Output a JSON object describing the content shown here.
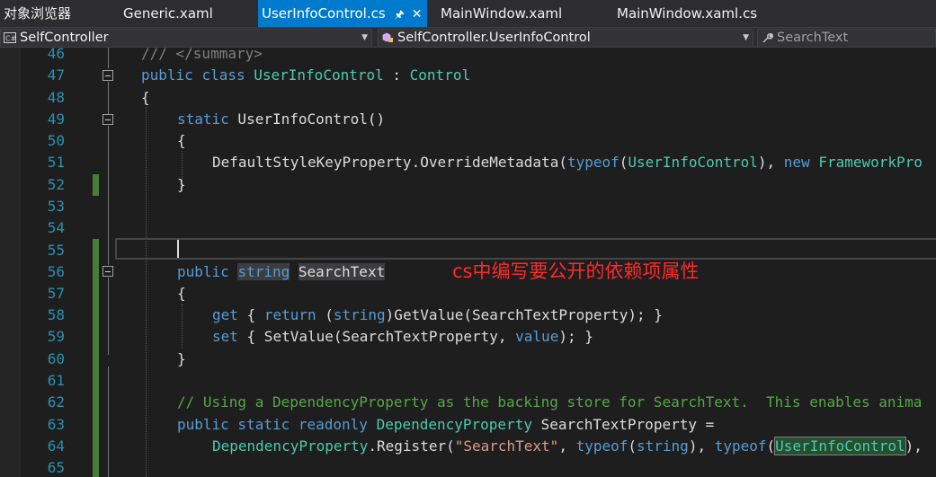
{
  "tabs": [
    {
      "label": "对象浏览器"
    },
    {
      "label": "Generic.xaml"
    },
    {
      "label": "UserInfoControl.cs",
      "active": true,
      "pin_icon": "pin-icon",
      "close_icon": "close-icon"
    },
    {
      "label": "MainWindow.xaml"
    },
    {
      "label": "MainWindow.xaml.cs"
    }
  ],
  "navbar": {
    "project": "SelfController",
    "type": "SelfController.UserInfoControl",
    "member": "SearchText",
    "project_icon": "csharp-project-icon",
    "type_icon": "class-icon",
    "member_icon": "wrench-property-icon"
  },
  "editor": {
    "line_numbers": [
      "46",
      "47",
      "48",
      "49",
      "50",
      "51",
      "52",
      "53",
      "54",
      "55",
      "56",
      "57",
      "58",
      "59",
      "60",
      "61",
      "62",
      "63",
      "64",
      "65"
    ],
    "lines": {
      "l46": "/// </summary>",
      "l47_kw1": "public",
      "l47_kw2": "class",
      "l47_name": "UserInfoControl",
      "l47_colon": " : ",
      "l47_base": "Control",
      "l48": "{",
      "l49_kw": "static",
      "l49_rest": " UserInfoControl()",
      "l50": "{",
      "l51_a": "DefaultStyleKeyProperty",
      "l51_b": ".OverrideMetadata(",
      "l51_kw": "typeof",
      "l51_c": "(",
      "l51_ty": "UserInfoControl",
      "l51_d": "), ",
      "l51_new": "new",
      "l51_ty2": " FrameworkPro",
      "l52": "}",
      "l56_kw": "public",
      "l56_ty": "string",
      "l56_name": "SearchText",
      "l57": "{",
      "l58_get": "get",
      "l58_a": " { ",
      "l58_ret": "return",
      "l58_b": " (",
      "l58_str": "string",
      "l58_c": ")GetValue(SearchTextProperty); }",
      "l59_set": "set",
      "l59_a": " { SetValue(SearchTextProperty, ",
      "l59_val": "value",
      "l59_b": "); }",
      "l60": "}",
      "l62": "// Using a DependencyProperty as the backing store for SearchText.  This enables anima",
      "l63_kw": "public static readonly",
      "l63_ty": "DependencyProperty",
      "l63_rest": " SearchTextProperty =",
      "l64_ty": "DependencyProperty",
      "l64_a": ".Register(",
      "l64_str": "\"SearchText\"",
      "l64_b": ", ",
      "l64_kw1": "typeof",
      "l64_c": "(",
      "l64_str2": "string",
      "l64_d": "), ",
      "l64_kw2": "typeof",
      "l64_e": "(",
      "l64_ty2": "UserInfoControl",
      "l64_f": "),"
    }
  },
  "annotation": "cs中编写要公开的依赖项属性",
  "colors": {
    "keyword": "#569cd6",
    "type": "#4ec9b0",
    "string": "#d69d85",
    "comment": "#57a64a",
    "annotation": "#ff2a2a",
    "accent": "#007acc"
  }
}
